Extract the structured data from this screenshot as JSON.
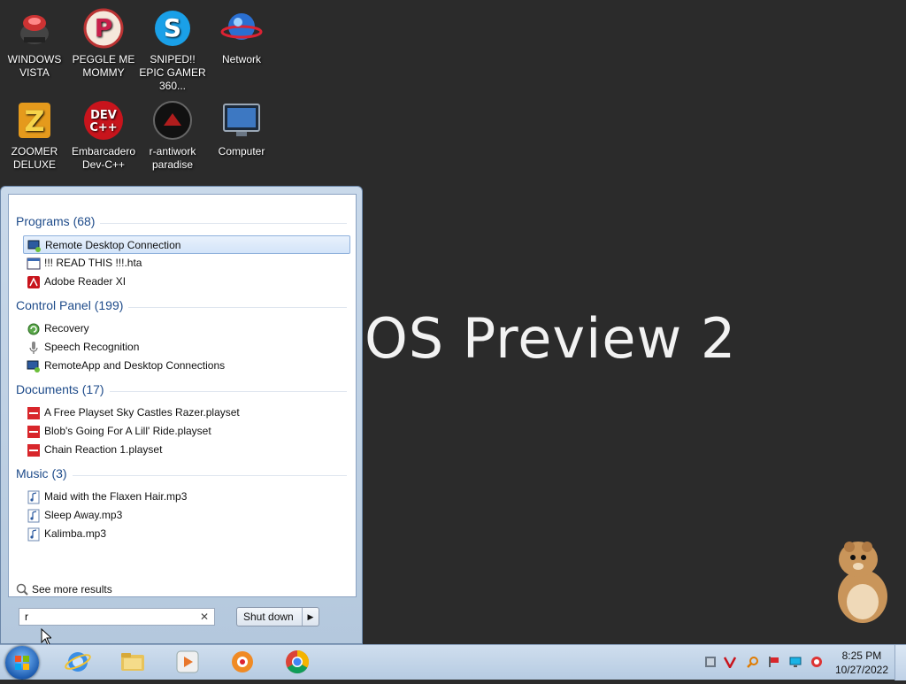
{
  "desktop": {
    "icons": [
      {
        "name": "WINDOWS VISTA"
      },
      {
        "name": "PEGGLE ME MOMMY"
      },
      {
        "name": "SNIPED!! EPIC GAMER 360..."
      },
      {
        "name": "Network"
      },
      {
        "name": "ZOOMER DELUXE"
      },
      {
        "name": "Embarcadero Dev-C++"
      },
      {
        "name": "r-antiwork paradise"
      },
      {
        "name": "Computer"
      }
    ],
    "wallpaper_text": "OS Preview 2"
  },
  "start_menu": {
    "groups": [
      {
        "header": "Programs (68)",
        "items": [
          "Remote Desktop Connection",
          "!!! READ THIS !!!.hta",
          "Adobe Reader XI"
        ]
      },
      {
        "header": "Control Panel (199)",
        "items": [
          "Recovery",
          "Speech Recognition",
          "RemoteApp and Desktop Connections"
        ]
      },
      {
        "header": "Documents (17)",
        "items": [
          "A Free Playset Sky Castles Razer.playset",
          "Blob's Going For A Lill' Ride.playset",
          "Chain Reaction 1.playset"
        ]
      },
      {
        "header": "Music (3)",
        "items": [
          "Maid with the Flaxen Hair.mp3",
          "Sleep Away.mp3",
          "Kalimba.mp3"
        ]
      }
    ],
    "see_more": "See more results",
    "search_value": "r",
    "shutdown_label": "Shut down"
  },
  "taskbar": {
    "time": "8:25 PM",
    "date": "10/27/2022"
  },
  "colors": {
    "group_header": "#1e4b8a",
    "selection": "#d3e4f9",
    "taskbar": "#c2d5ea"
  }
}
